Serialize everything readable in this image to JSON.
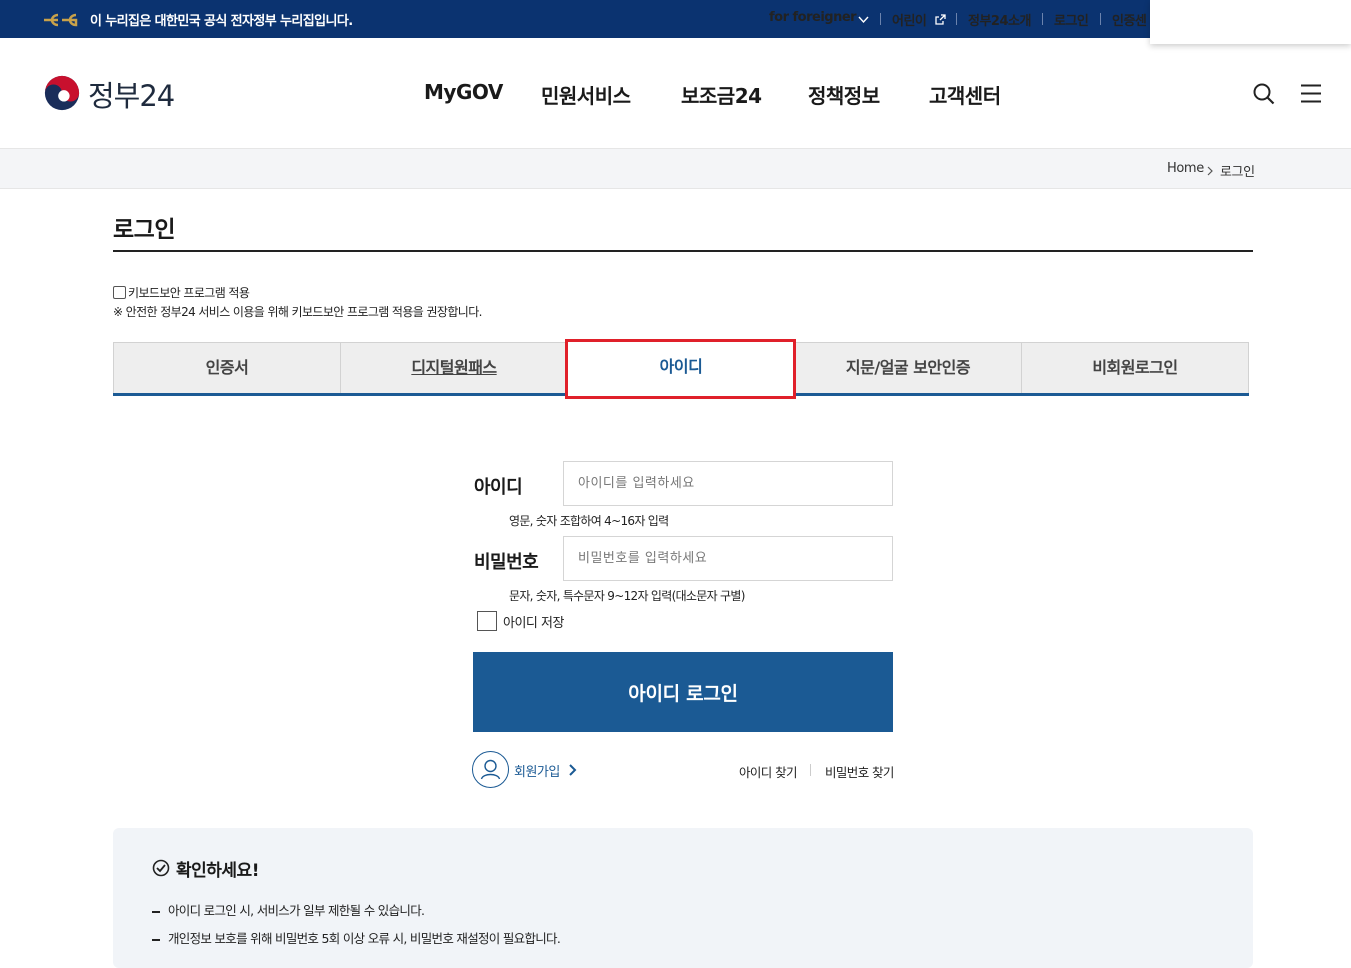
{
  "banner": {
    "notice": "이 누리집은 대한민국 공식 전자정부 누리집입니다.",
    "utilities": [
      "for foreigner",
      "어린이",
      "정부24소개",
      "로그인",
      "인증센"
    ]
  },
  "header": {
    "logo_text": "정부24",
    "nav": [
      "MyGOV",
      "민원서비스",
      "보조금24",
      "정책정보",
      "고객센터"
    ]
  },
  "breadcrumb": {
    "home": "Home",
    "current": "로그인"
  },
  "page": {
    "title": "로그인",
    "keyboard_security_label": "키보드보안 프로그램 적용",
    "keyboard_security_note": "※ 안전한 정부24 서비스 이용을 위해 키보드보안 프로그램 적용을 권장합니다."
  },
  "tabs": [
    {
      "label": "인증서",
      "active": false
    },
    {
      "label": "디지털원패스",
      "active": false
    },
    {
      "label": "아이디",
      "active": true
    },
    {
      "label": "지문/얼굴 보안인증",
      "active": false
    },
    {
      "label": "비회원로그인",
      "active": false
    }
  ],
  "form": {
    "id_label": "아이디",
    "id_placeholder": "아이디를 입력하세요",
    "id_hint": "영문, 숫자 조합하여 4~16자 입력",
    "pw_label": "비밀번호",
    "pw_placeholder": "비밀번호를 입력하세요",
    "pw_hint": "문자, 숫자, 특수문자 9~12자 입력(대소문자 구별)",
    "save_id_label": "아이디 저장",
    "login_button": "아이디 로그인",
    "join_label": "회원가입",
    "find_id": "아이디 찾기",
    "find_pw": "비밀번호 찾기"
  },
  "notice": {
    "title": "확인하세요!",
    "items": [
      "아이디 로그인 시, 서비스가 일부 제한될 수 있습니다.",
      "개인정보 보호를 위해 비밀번호 5회 이상 오류 시, 비밀번호 재설정이 필요합니다."
    ]
  },
  "colors": {
    "banner": "#0b3370",
    "primary": "#1b5a94",
    "highlight": "#e0202a"
  }
}
